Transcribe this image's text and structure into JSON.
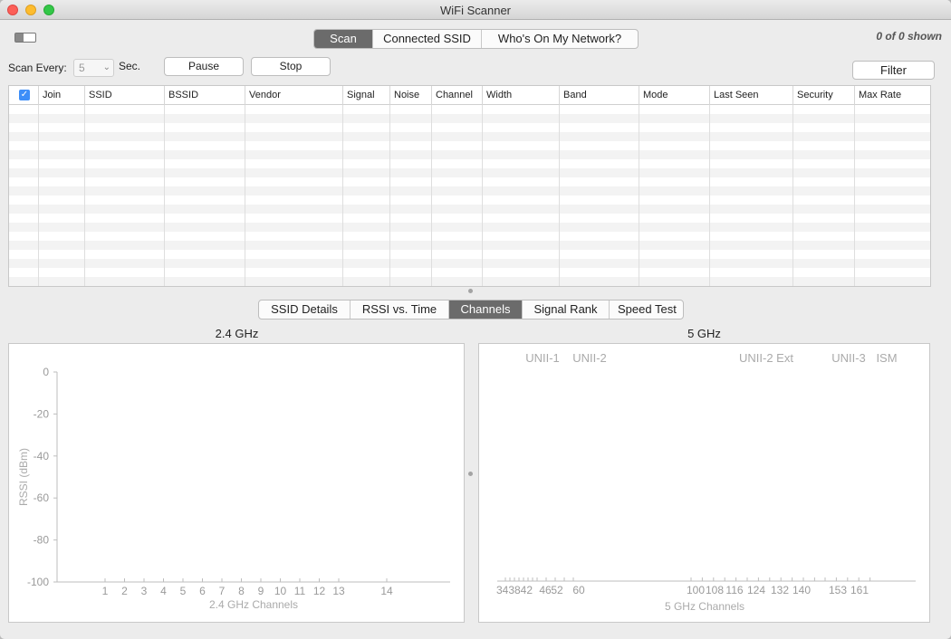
{
  "window": {
    "title": "WiFi Scanner"
  },
  "top_tabs": [
    {
      "label": "Scan",
      "active": true
    },
    {
      "label": "Connected SSID",
      "active": false
    },
    {
      "label": "Who's On My Network?",
      "active": false
    }
  ],
  "shown_count": "0 of 0 shown",
  "controls": {
    "scan_every_label": "Scan Every:",
    "scan_interval_value": "5",
    "sec_label": "Sec.",
    "pause_label": "Pause",
    "stop_label": "Stop",
    "filter_label": "Filter"
  },
  "table": {
    "select_all_checked": true,
    "columns": [
      "Join",
      "SSID",
      "BSSID",
      "Vendor",
      "Signal",
      "Noise",
      "Channel",
      "Width",
      "Band",
      "Mode",
      "Last Seen",
      "Security",
      "Max Rate"
    ],
    "rows": []
  },
  "bottom_tabs": [
    {
      "label": "SSID Details",
      "active": false
    },
    {
      "label": "RSSI vs. Time",
      "active": false
    },
    {
      "label": "Channels",
      "active": true
    },
    {
      "label": "Signal Rank",
      "active": false
    },
    {
      "label": "Speed Test",
      "active": false
    }
  ],
  "chart_data": [
    {
      "type": "bar",
      "title": "2.4 GHz",
      "xlabel": "2.4 GHz Channels",
      "ylabel": "RSSI (dBm)",
      "ylim": [
        -100,
        0
      ],
      "y_ticks": [
        0,
        -20,
        -40,
        -60,
        -80,
        -100
      ],
      "x_ticks": [
        1,
        2,
        3,
        4,
        5,
        6,
        7,
        8,
        9,
        10,
        11,
        12,
        13,
        14
      ],
      "series": []
    },
    {
      "type": "bar",
      "title": "5 GHz",
      "xlabel": "5 GHz Channels",
      "band_labels": [
        "UNII-1",
        "UNII-2",
        "UNII-2 Ext",
        "UNII-3",
        "ISM"
      ],
      "x_ticks": [
        34,
        36,
        38,
        40,
        42,
        44,
        46,
        48,
        52,
        56,
        60,
        64,
        100,
        104,
        108,
        112,
        116,
        120,
        124,
        128,
        132,
        136,
        140,
        144,
        149,
        153,
        157,
        161,
        165
      ],
      "x_tick_label_text": [
        "343842",
        "46",
        "52",
        "60",
        "100",
        "108",
        "116",
        "124",
        "132",
        "140",
        "153",
        "161"
      ],
      "series": []
    }
  ]
}
